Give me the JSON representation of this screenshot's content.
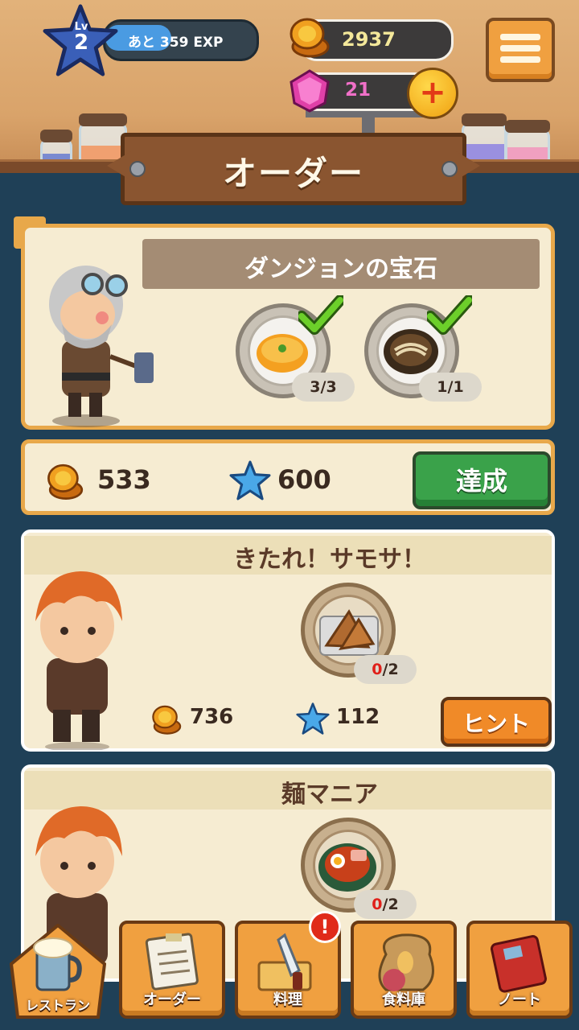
{
  "hud": {
    "level_label": "Lv",
    "level": "2",
    "exp_text": "あと 359 EXP",
    "exp_progress": 0.45,
    "coins": "2937",
    "gems": "21"
  },
  "screen_title": "オーダー",
  "orders": [
    {
      "title": "ダンジョンの宝石",
      "items": [
        {
          "icon": "soup-icon",
          "count": "3/3",
          "complete": true
        },
        {
          "icon": "noodle-soup-icon",
          "count": "1/1",
          "complete": true
        }
      ],
      "reward_coins": "533",
      "reward_stars": "600",
      "action": "達成"
    },
    {
      "title": "きたれ！サモサ！",
      "items": [
        {
          "icon": "samosa-icon",
          "count_done": "0",
          "count_total": "/2",
          "complete": false
        }
      ],
      "reward_coins": "736",
      "reward_stars": "112",
      "action": "ヒント"
    },
    {
      "title": "麺マニア",
      "items": [
        {
          "icon": "ramen-icon",
          "count_done": "0",
          "count_total": "/2",
          "complete": false
        }
      ]
    }
  ],
  "nav": [
    {
      "label": "レストラン",
      "icon": "beer-mug-icon"
    },
    {
      "label": "オーダー",
      "icon": "order-paper-icon"
    },
    {
      "label": "料理",
      "icon": "cooking-knife-icon",
      "badge": "!"
    },
    {
      "label": "食料庫",
      "icon": "food-sack-icon"
    },
    {
      "label": "ノート",
      "icon": "notebook-icon"
    }
  ],
  "colors": {
    "background": "#1f4057",
    "card": "#f6ecd2",
    "accent_orange": "#f0a040",
    "complete_green": "#3aa24a",
    "check_green": "#5bbf2a"
  }
}
